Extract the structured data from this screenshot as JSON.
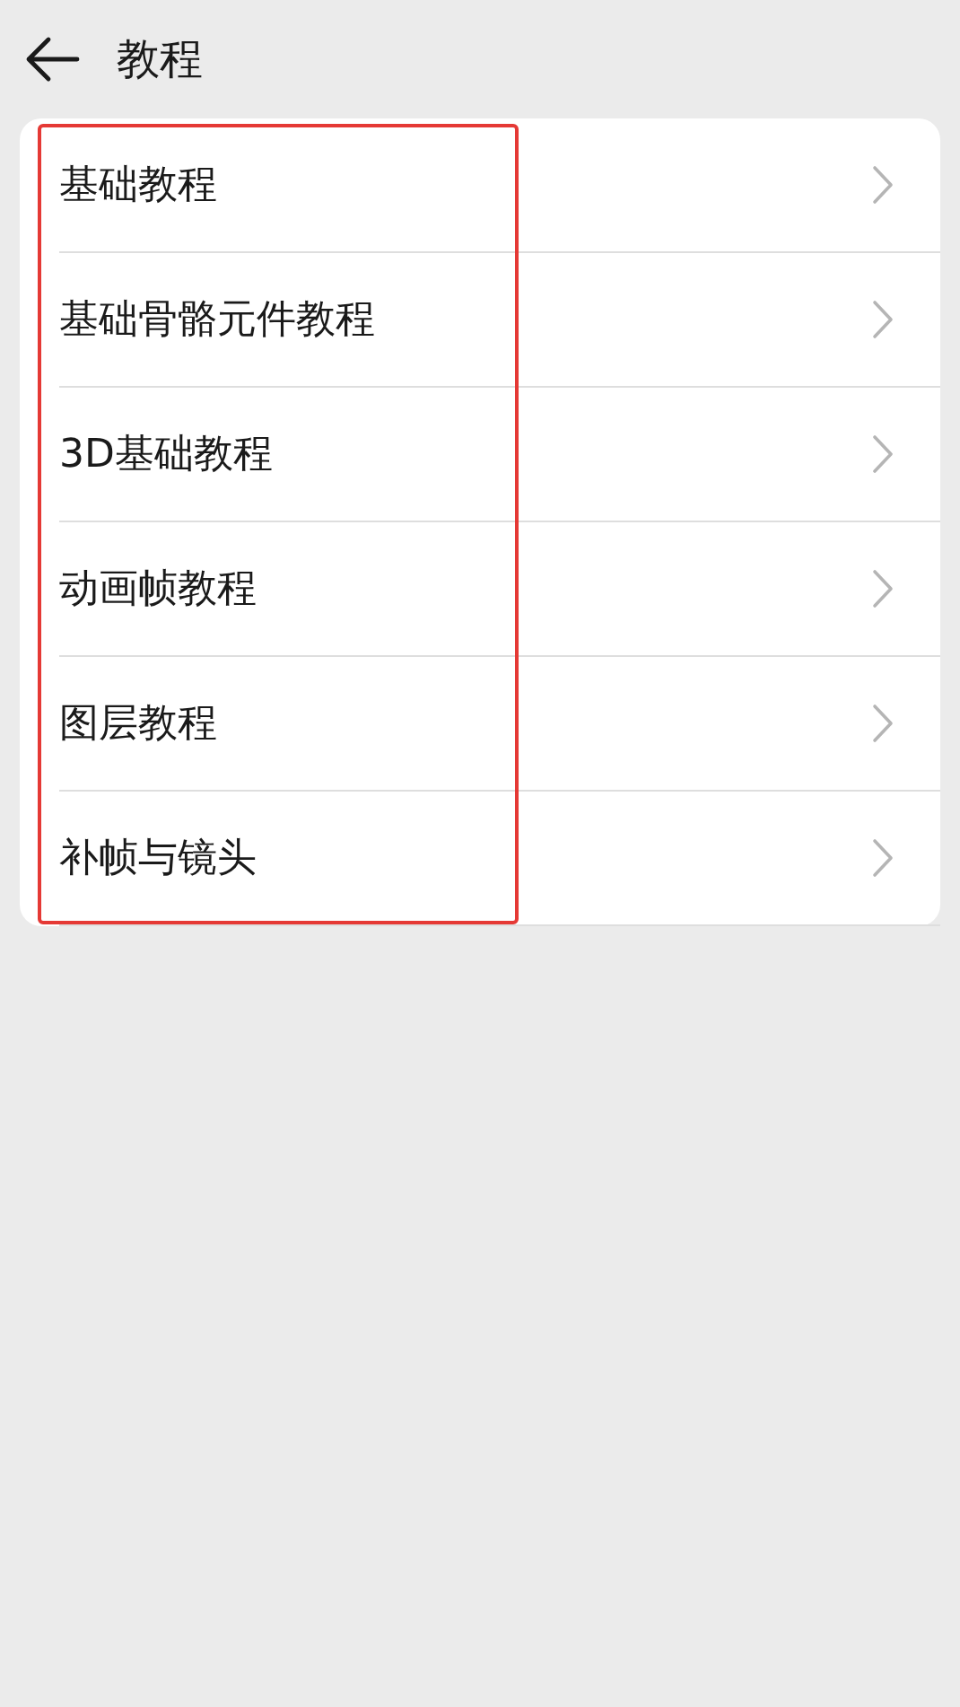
{
  "header": {
    "title": "教程"
  },
  "items": [
    {
      "label": "基础教程"
    },
    {
      "label": "基础骨骼元件教程"
    },
    {
      "label": "3D基础教程"
    },
    {
      "label": "动画帧教程"
    },
    {
      "label": "图层教程"
    },
    {
      "label": "补帧与镜头"
    }
  ]
}
